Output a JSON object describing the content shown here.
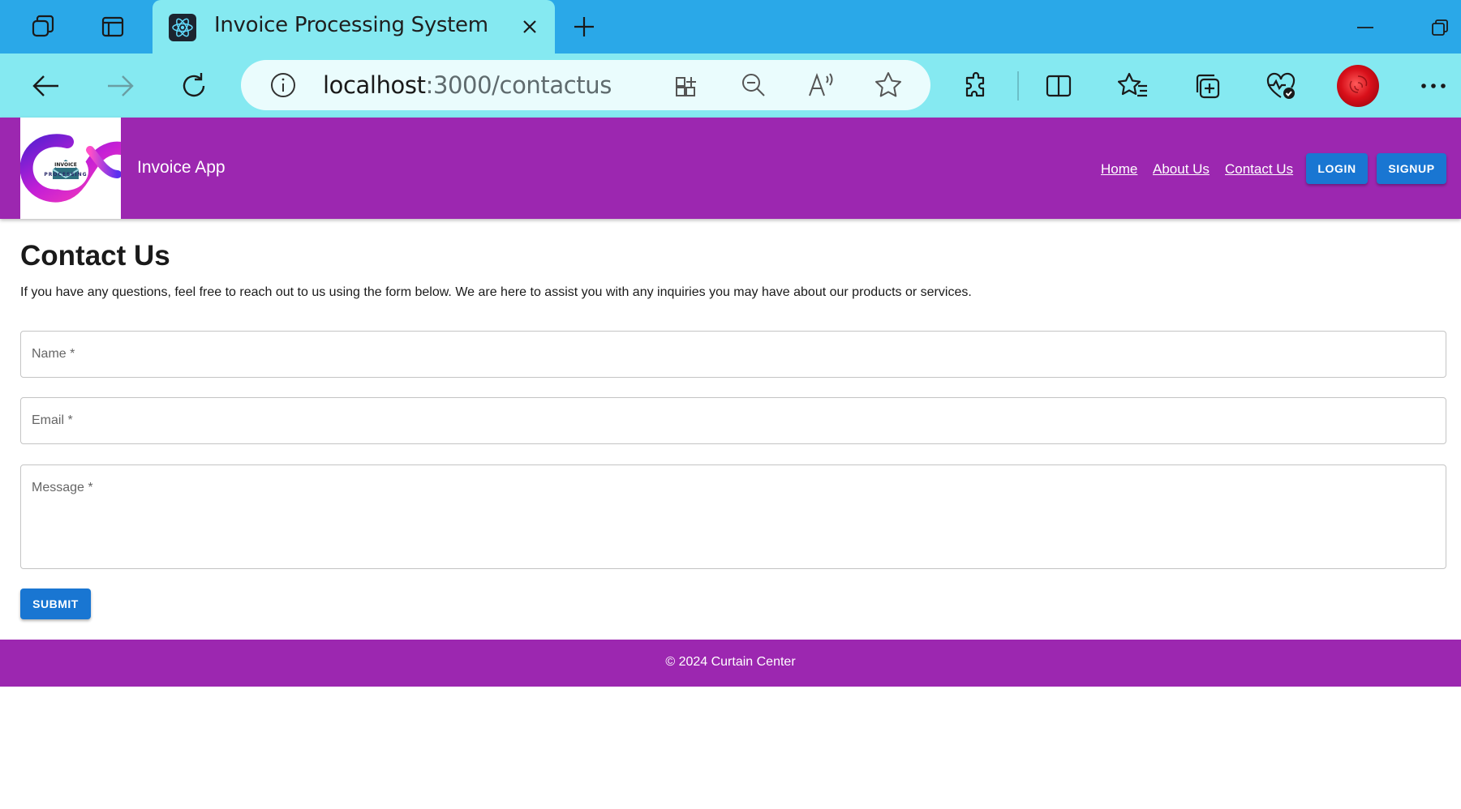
{
  "browser": {
    "tab_title": "Invoice Processing System",
    "url_host": "localhost",
    "url_path": ":3000/contactus",
    "icons": [
      "workspaces-icon",
      "vertical-tabs-icon",
      "react-favicon-icon",
      "close-tab-icon",
      "new-tab-icon",
      "minimize-icon",
      "restore-icon",
      "back-icon",
      "forward-icon",
      "refresh-icon",
      "site-info-icon",
      "app-available-icon",
      "zoom-out-icon",
      "read-aloud-icon",
      "favorite-star-icon",
      "extensions-icon",
      "split-screen-icon",
      "favorites-icon",
      "collections-icon",
      "browser-essentials-icon",
      "profile-avatar",
      "more-menu-icon"
    ]
  },
  "header": {
    "brand": "Invoice App",
    "logo_text_top": "INVOICE",
    "logo_text_bottom": "PROCESSING",
    "nav": {
      "home": "Home",
      "about": "About Us",
      "contact": "Contact Us"
    },
    "login": "LOGIN",
    "signup": "SIGNUP"
  },
  "main": {
    "title": "Contact Us",
    "intro": "If you have any questions, feel free to reach out to us using the form below. We are here to assist you with any inquiries you may have about our products or services.",
    "fields": {
      "name": "Name *",
      "email": "Email *",
      "message": "Message *"
    },
    "submit": "SUBMIT"
  },
  "footer": {
    "copyright": "© 2024 Curtain Center"
  },
  "colors": {
    "tab_strip": "#2aa8e8",
    "toolbar": "#85e9f1",
    "header": "#9c27b0",
    "button": "#1976d2"
  }
}
